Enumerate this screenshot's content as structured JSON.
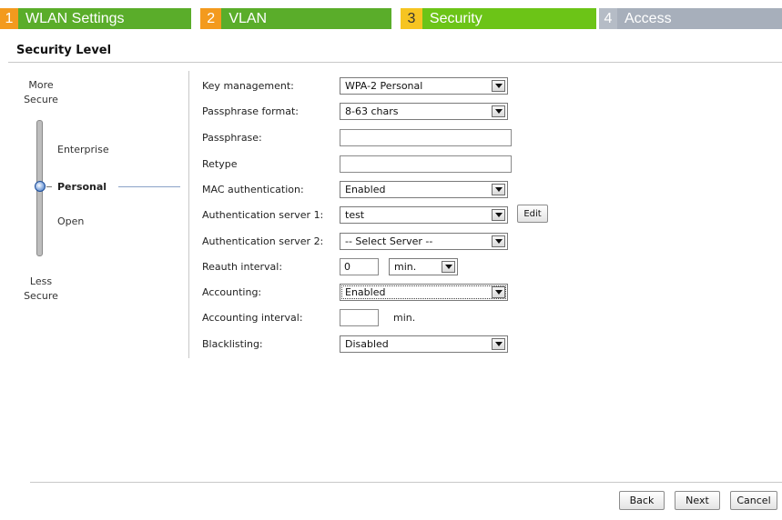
{
  "wizard": {
    "tabs": [
      {
        "num": "1",
        "label": "WLAN Settings",
        "num_color": "#f39a1e",
        "label_color": "#5aad2a"
      },
      {
        "num": "2",
        "label": "VLAN",
        "num_color": "#f39a1e",
        "label_color": "#5aad2a"
      },
      {
        "num": "3",
        "label": "Security",
        "num_color": "#f6c421",
        "label_color": "#6cc417"
      },
      {
        "num": "4",
        "label": "Access",
        "num_color": "#b5bcc6",
        "label_color": "#a7afbb"
      }
    ]
  },
  "section_title": "Security Level",
  "security_levels": {
    "more_secure": "More Secure",
    "less_secure": "Less Secure",
    "levels": [
      "Enterprise",
      "Personal",
      "Open"
    ],
    "selected": "Personal"
  },
  "form": {
    "key_management": {
      "label": "Key management:",
      "value": "WPA-2 Personal"
    },
    "passphrase_format": {
      "label": "Passphrase format:",
      "value": "8-63 chars"
    },
    "passphrase": {
      "label": "Passphrase:",
      "value": ""
    },
    "retype": {
      "label": "Retype",
      "value": ""
    },
    "mac_authentication": {
      "label": "MAC authentication:",
      "value": "Enabled"
    },
    "auth_server_1": {
      "label": "Authentication server 1:",
      "value": "test",
      "edit_label": "Edit"
    },
    "auth_server_2": {
      "label": "Authentication server 2:",
      "value": "-- Select Server --"
    },
    "reauth_interval": {
      "label": "Reauth interval:",
      "value": "0",
      "unit": "min."
    },
    "accounting": {
      "label": "Accounting:",
      "value": "Enabled"
    },
    "accounting_interval": {
      "label": "Accounting interval:",
      "value": "",
      "unit": "min."
    },
    "blacklisting": {
      "label": "Blacklisting:",
      "value": "Disabled"
    }
  },
  "footer": {
    "back_label": "Back",
    "next_label": "Next",
    "cancel_label": "Cancel"
  }
}
